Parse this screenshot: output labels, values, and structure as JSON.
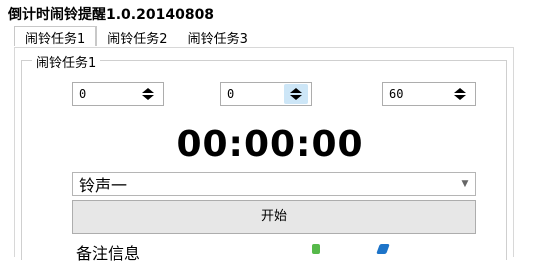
{
  "window": {
    "title": "倒计时闹铃提醒1.0.20140808"
  },
  "tabs": [
    {
      "label": "闹铃任务1",
      "active": true
    },
    {
      "label": "闹铃任务2",
      "active": false
    },
    {
      "label": "闹铃任务3",
      "active": false
    }
  ],
  "task": {
    "group_label": "闹铃任务1",
    "hours_value": "0",
    "minutes_value": "0",
    "seconds_value": "60",
    "countdown": "00:00:00",
    "ringtone_selected": "铃声一",
    "start_button_label": "开始",
    "notes_label": "备注信息"
  },
  "colors": {
    "spin_hover": "#cde6f7",
    "button_bg": "#e7e7e7",
    "border": "#adadad"
  },
  "icons": {
    "spin_up": "triangle-up-icon",
    "spin_down": "triangle-down-icon",
    "dropdown": "chevron-down-icon"
  }
}
